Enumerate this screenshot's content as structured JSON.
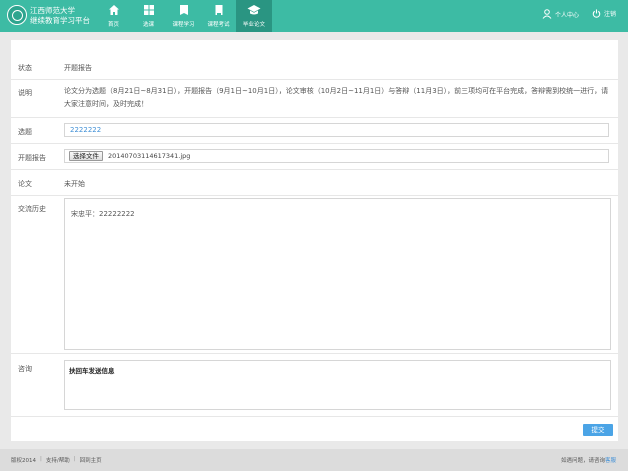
{
  "header": {
    "brand_line1": "江西师范大学",
    "brand_line2": "继续教育学习平台",
    "nav": [
      {
        "label": "首页",
        "icon": "home-icon"
      },
      {
        "label": "选课",
        "icon": "grid-icon"
      },
      {
        "label": "课程学习",
        "icon": "book-icon"
      },
      {
        "label": "课程考试",
        "icon": "exam-icon"
      },
      {
        "label": "毕业论文",
        "icon": "graduation-cap-icon",
        "active": true
      }
    ],
    "user_center": "个人中心",
    "logout": "注销"
  },
  "form": {
    "status_label": "状态",
    "status_value": "开题报告",
    "desc_label": "说明",
    "desc_text": "论文分为选题（8月21日~8月31日），开题报告（9月1日~10月1日），论文审核（10月2日~11月1日）与答辩（11月3日），前三项均可在平台完成，答辩需到校统一进行，请大家注意时间，及时完成！",
    "topic_label": "选题",
    "topic_value": "2222222",
    "proposal_label": "开题报告",
    "file_button": "选择文件",
    "file_name": "20140703114617341.jpg",
    "thesis_label": "论文",
    "thesis_value": "未开始",
    "history_label": "交流历史",
    "history_message": "宋忠平：22222222",
    "consult_label": "咨询",
    "consult_text": "扶回车发送信息",
    "submit_label": "提交"
  },
  "footer": {
    "copyright": "版权2014",
    "support": "支持/帮助",
    "back_home": "回到主页",
    "question_prefix": "如遇问题，请咨询",
    "question_link": "客服"
  },
  "colors": {
    "header_bg": "#3dbba4",
    "nav_active_bg": "#2a9582",
    "submit_bg": "#4ba4e6",
    "link": "#3f8fd6"
  }
}
